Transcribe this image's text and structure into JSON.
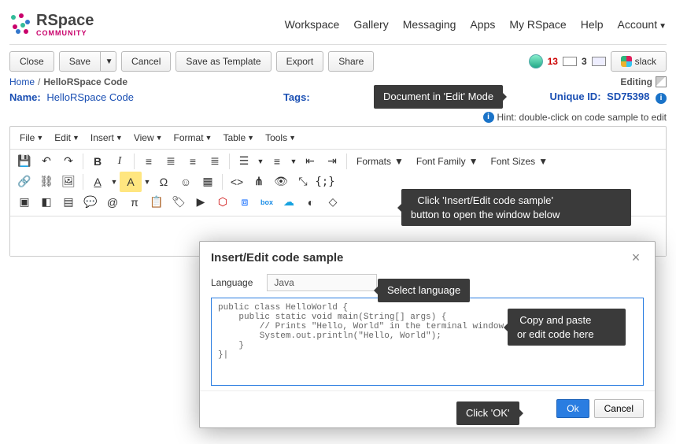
{
  "brand": {
    "name": "RSpace",
    "sub": "COMMUNITY"
  },
  "topnav": {
    "workspace": "Workspace",
    "gallery": "Gallery",
    "messaging": "Messaging",
    "apps": "Apps",
    "myrspace": "My RSpace",
    "help": "Help",
    "account": "Account"
  },
  "toolbar": {
    "close": "Close",
    "save": "Save",
    "cancel": "Cancel",
    "save_as_template": "Save as Template",
    "export": "Export",
    "share": "Share",
    "count1": "13",
    "count2": "3",
    "slack": "slack"
  },
  "breadcrumb": {
    "home": "Home",
    "doc": "HelloRSpace Code",
    "status": "Editing"
  },
  "meta": {
    "name_label": "Name:",
    "name_value": "HelloRSpace Code",
    "tags_label": "Tags:",
    "uid_label": "Unique ID:",
    "uid_value": "SD75398"
  },
  "hint": "Hint: double-click on code sample to edit",
  "editor": {
    "menus": {
      "file": "File",
      "edit": "Edit",
      "insert": "Insert",
      "view": "View",
      "format": "Format",
      "table": "Table",
      "tools": "Tools"
    },
    "dropdowns": {
      "formats": "Formats",
      "fontfamily": "Font Family",
      "fontsizes": "Font Sizes"
    }
  },
  "annotations": {
    "editmode": "Document in 'Edit' Mode",
    "codesample_l1": "Click 'Insert/Edit code sample'",
    "codesample_l2": "button to open the window below",
    "selectlang": "Select language",
    "copy_l1": "Copy and paste",
    "copy_l2": "or edit code here",
    "clickok": "Click 'OK'"
  },
  "modal": {
    "title": "Insert/Edit code sample",
    "lang_label": "Language",
    "lang_value": "Java",
    "code": "public class HelloWorld {\n    public static void main(String[] args) {\n        // Prints \"Hello, World\" in the terminal window.\n        System.out.println(\"Hello, World\");\n    }\n}|",
    "ok": "Ok",
    "cancel": "Cancel"
  }
}
